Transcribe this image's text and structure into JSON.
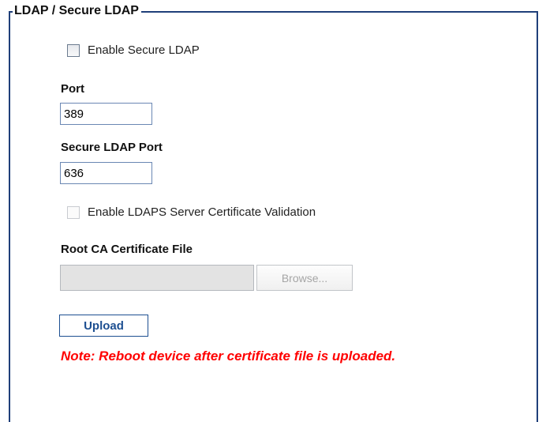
{
  "section": {
    "title": "LDAP / Secure LDAP"
  },
  "enable_secure_ldap": {
    "label": "Enable Secure LDAP",
    "checked": false
  },
  "port": {
    "label": "Port",
    "value": "389"
  },
  "secure_ldap_port": {
    "label": "Secure LDAP Port",
    "value": "636"
  },
  "ldaps_validation": {
    "label": "Enable LDAPS Server Certificate Validation",
    "checked": false,
    "disabled": true
  },
  "root_ca": {
    "label": "Root CA Certificate File",
    "file_value": "",
    "browse_label": "Browse..."
  },
  "upload": {
    "label": "Upload"
  },
  "note": {
    "text": "Note: Reboot device after certificate file is uploaded."
  },
  "colors": {
    "frame_border": "#1f3f7a",
    "input_border": "#6a87b3",
    "upload_text": "#1d4f91",
    "note_text": "#ff0000"
  }
}
